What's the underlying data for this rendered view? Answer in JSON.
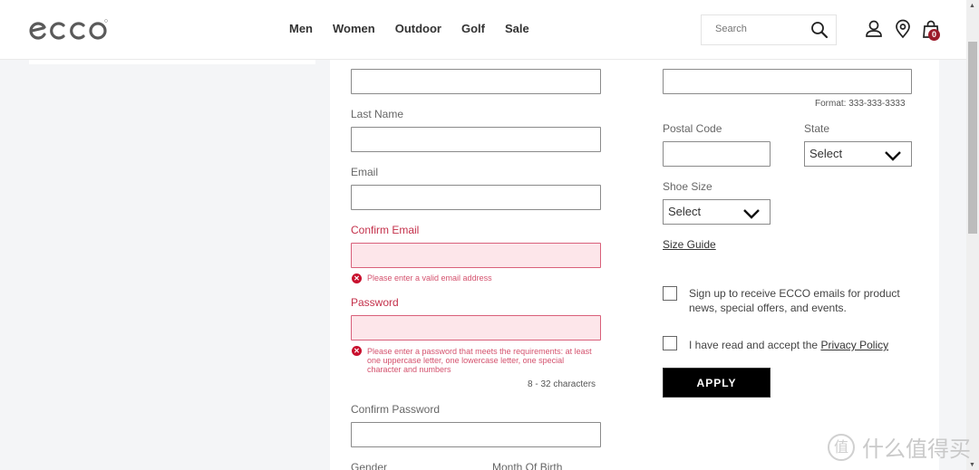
{
  "header": {
    "brand": "ecco",
    "nav": [
      "Men",
      "Women",
      "Outdoor",
      "Golf",
      "Sale"
    ],
    "search_placeholder": "Search",
    "cart_count": "0",
    "icons": [
      "search-icon",
      "account-icon",
      "store-locator-icon",
      "shopping-bag-icon"
    ]
  },
  "form": {
    "left": {
      "last_name_label": "Last Name",
      "email_label": "Email",
      "confirm_email_label": "Confirm Email",
      "confirm_email_error": "Please enter a valid email address",
      "password_label": "Password",
      "password_error": "Please enter a password that meets the requirements: at least one uppercase letter, one lowercase letter, one special character and numbers",
      "password_hint": "8 - 32 characters",
      "confirm_password_label": "Confirm Password",
      "gender_label": "Gender",
      "month_of_birth_label": "Month Of Birth"
    },
    "right": {
      "phone_format_hint": "Format: 333-333-3333",
      "postal_code_label": "Postal Code",
      "state_label": "State",
      "state_value": "Select",
      "shoe_size_label": "Shoe Size",
      "shoe_size_value": "Select",
      "size_guide_link": "Size Guide",
      "newsletter_text": "Sign up to receive ECCO emails for product news, special offers, and events.",
      "privacy_text": "I have read and accept the ",
      "privacy_link": "Privacy Policy",
      "apply_button": "APPLY"
    }
  },
  "colors": {
    "error": "#c4314b",
    "error_bg": "#fde6ea",
    "cart_badge": "#9b1b2a",
    "button_bg": "#000000"
  },
  "watermark": {
    "circle": "值",
    "text": "什么值得买"
  }
}
